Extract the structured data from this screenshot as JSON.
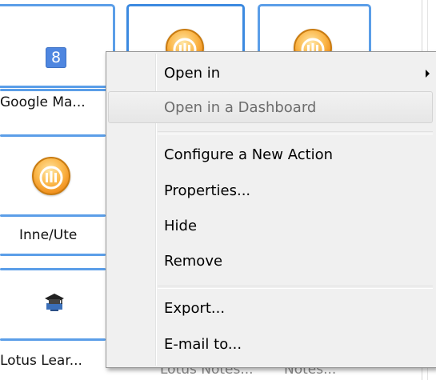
{
  "tiles": {
    "google": {
      "label": "Google Ma...",
      "icon": "google-maps-icon",
      "icon_glyph": "8"
    },
    "inne_ute": {
      "label": "Inne/Ute",
      "icon": "lotus-connections-icon"
    },
    "lotus_learning": {
      "label": "Lotus Lear...",
      "icon": "lotus-learning-icon"
    },
    "partial_middle": {
      "label": "Lotus Notes...",
      "icon": "lotus-connections-icon"
    },
    "partial_right": {
      "label": "Notes...",
      "icon": "lotus-connections-icon"
    }
  },
  "context_menu": {
    "items": [
      {
        "label": "Open in",
        "enabled": true,
        "has_submenu": true
      },
      {
        "label": "Open in a Dashboard",
        "enabled": false,
        "highlighted": true
      },
      {
        "label": "Configure a New Action",
        "enabled": true
      },
      {
        "label": "Properties...",
        "enabled": true
      },
      {
        "label": "Hide",
        "enabled": true
      },
      {
        "label": "Remove",
        "enabled": true
      },
      {
        "label": "Export...",
        "enabled": true
      },
      {
        "label": "E-mail to...",
        "enabled": true
      }
    ],
    "submenu_icon": "submenu-arrow-icon"
  },
  "colors": {
    "tile_border": "#5b9ee8",
    "menu_background": "#f0f0f0",
    "disabled_text": "#6d6d6d",
    "orb_orange": "#fbb84b"
  }
}
